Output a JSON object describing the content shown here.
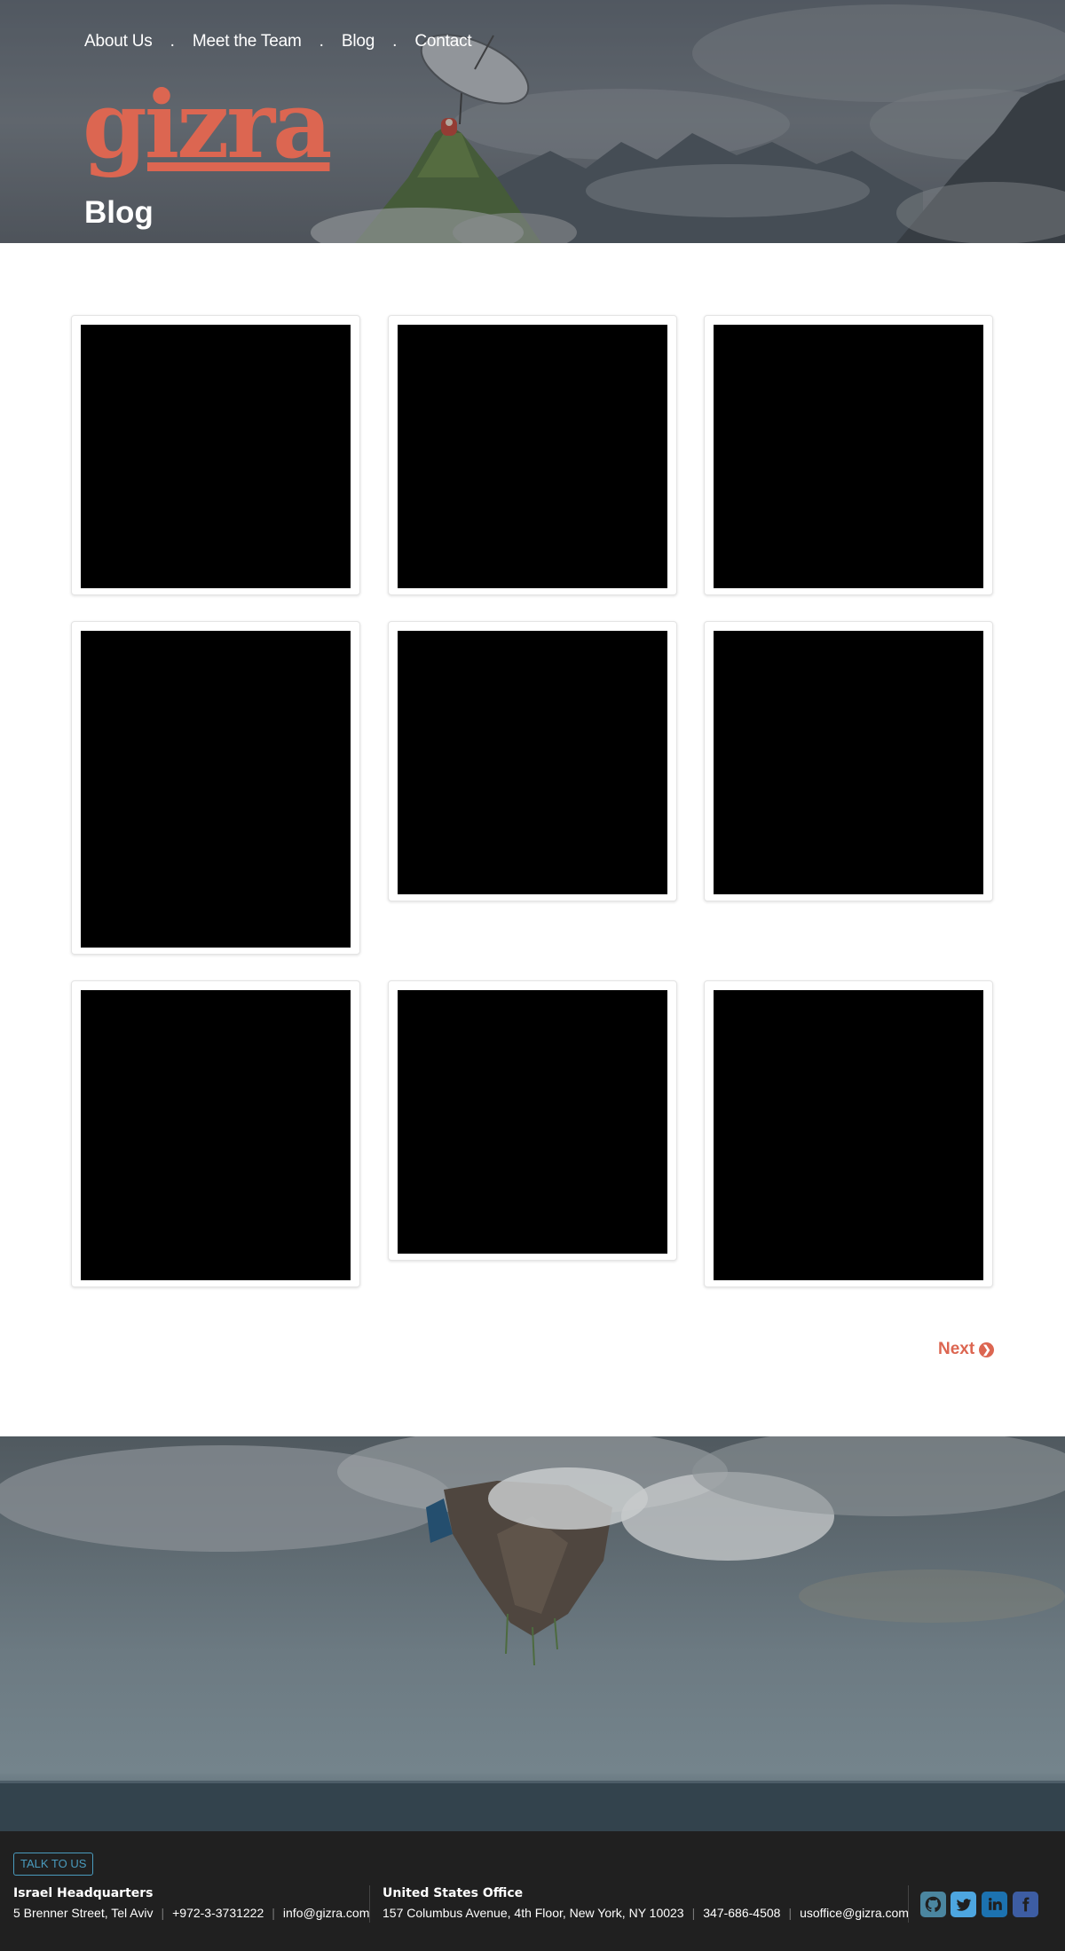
{
  "header": {
    "nav": {
      "about": "About Us",
      "team": "Meet the Team",
      "blog": "Blog",
      "contact": "Contact",
      "separator": "."
    },
    "logo_text": "gizra",
    "page_title": "Blog"
  },
  "blog_cards": 9,
  "pagination": {
    "next_label": "Next",
    "next_icon": "chevron-circle-right-icon"
  },
  "footer": {
    "talk_button": "TALK TO US",
    "israel": {
      "title": "Israel Headquarters",
      "address": "5 Brenner Street, Tel Aviv",
      "phone": "+972-3-3731222",
      "email": "info@gizra.com"
    },
    "us": {
      "title": "United States Office",
      "address": "157 Columbus Avenue, 4th Floor, New York, NY 10023",
      "phone": "347-686-4508",
      "email": "usoffice@gizra.com"
    },
    "social_icons": [
      "github-icon",
      "twitter-icon",
      "linkedin-icon",
      "facebook-icon"
    ]
  },
  "colors": {
    "accent": "#dc6651",
    "footer_bg": "#202020",
    "talk_border": "#4a9bbe",
    "github": "#4b86a0",
    "twitter": "#4da6e0",
    "linkedin": "#1c72b0",
    "facebook": "#3d5da3"
  }
}
